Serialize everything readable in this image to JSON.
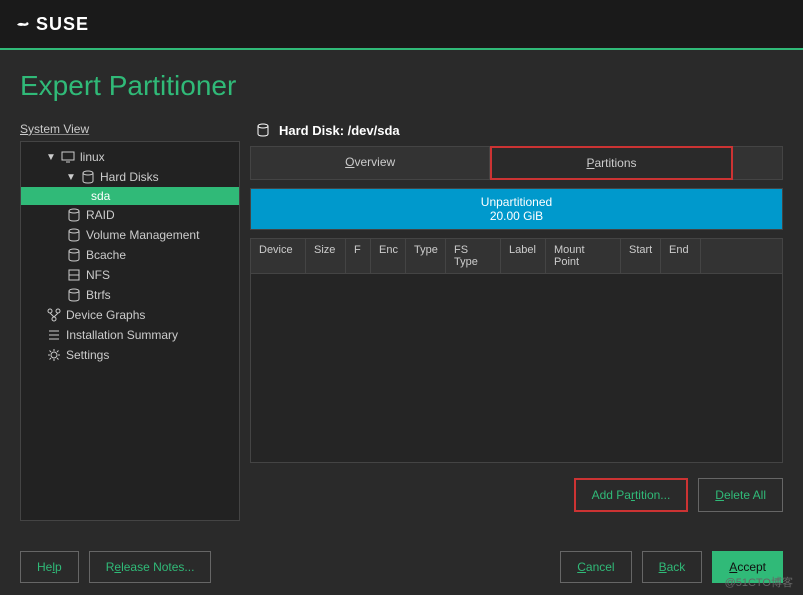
{
  "brand": "SUSE",
  "title": "Expert Partitioner",
  "sidebar": {
    "label": "System View",
    "items": [
      {
        "label": "linux",
        "icon": "monitor"
      },
      {
        "label": "Hard Disks",
        "icon": "disk"
      },
      {
        "label": "sda",
        "icon": ""
      },
      {
        "label": "RAID",
        "icon": "disk"
      },
      {
        "label": "Volume Management",
        "icon": "disk"
      },
      {
        "label": "Bcache",
        "icon": "disk"
      },
      {
        "label": "NFS",
        "icon": "network"
      },
      {
        "label": "Btrfs",
        "icon": "disk"
      },
      {
        "label": "Device Graphs",
        "icon": "graph"
      },
      {
        "label": "Installation Summary",
        "icon": "list"
      },
      {
        "label": "Settings",
        "icon": "gear"
      }
    ]
  },
  "panel": {
    "header": "Hard Disk: /dev/sda",
    "tabs": {
      "overview": "Overview",
      "partitions": "Partitions"
    },
    "partition_bar": {
      "label": "Unpartitioned",
      "size": "20.00 GiB"
    },
    "columns": [
      "Device",
      "Size",
      "F",
      "Enc",
      "Type",
      "FS Type",
      "Label",
      "Mount Point",
      "Start",
      "End"
    ]
  },
  "buttons": {
    "add_partition": "Add Partition...",
    "delete_all": "Delete All",
    "help": "Help",
    "release_notes": "Release Notes...",
    "cancel": "Cancel",
    "back": "Back",
    "accept": "Accept"
  },
  "watermark": "@51CTO博客"
}
